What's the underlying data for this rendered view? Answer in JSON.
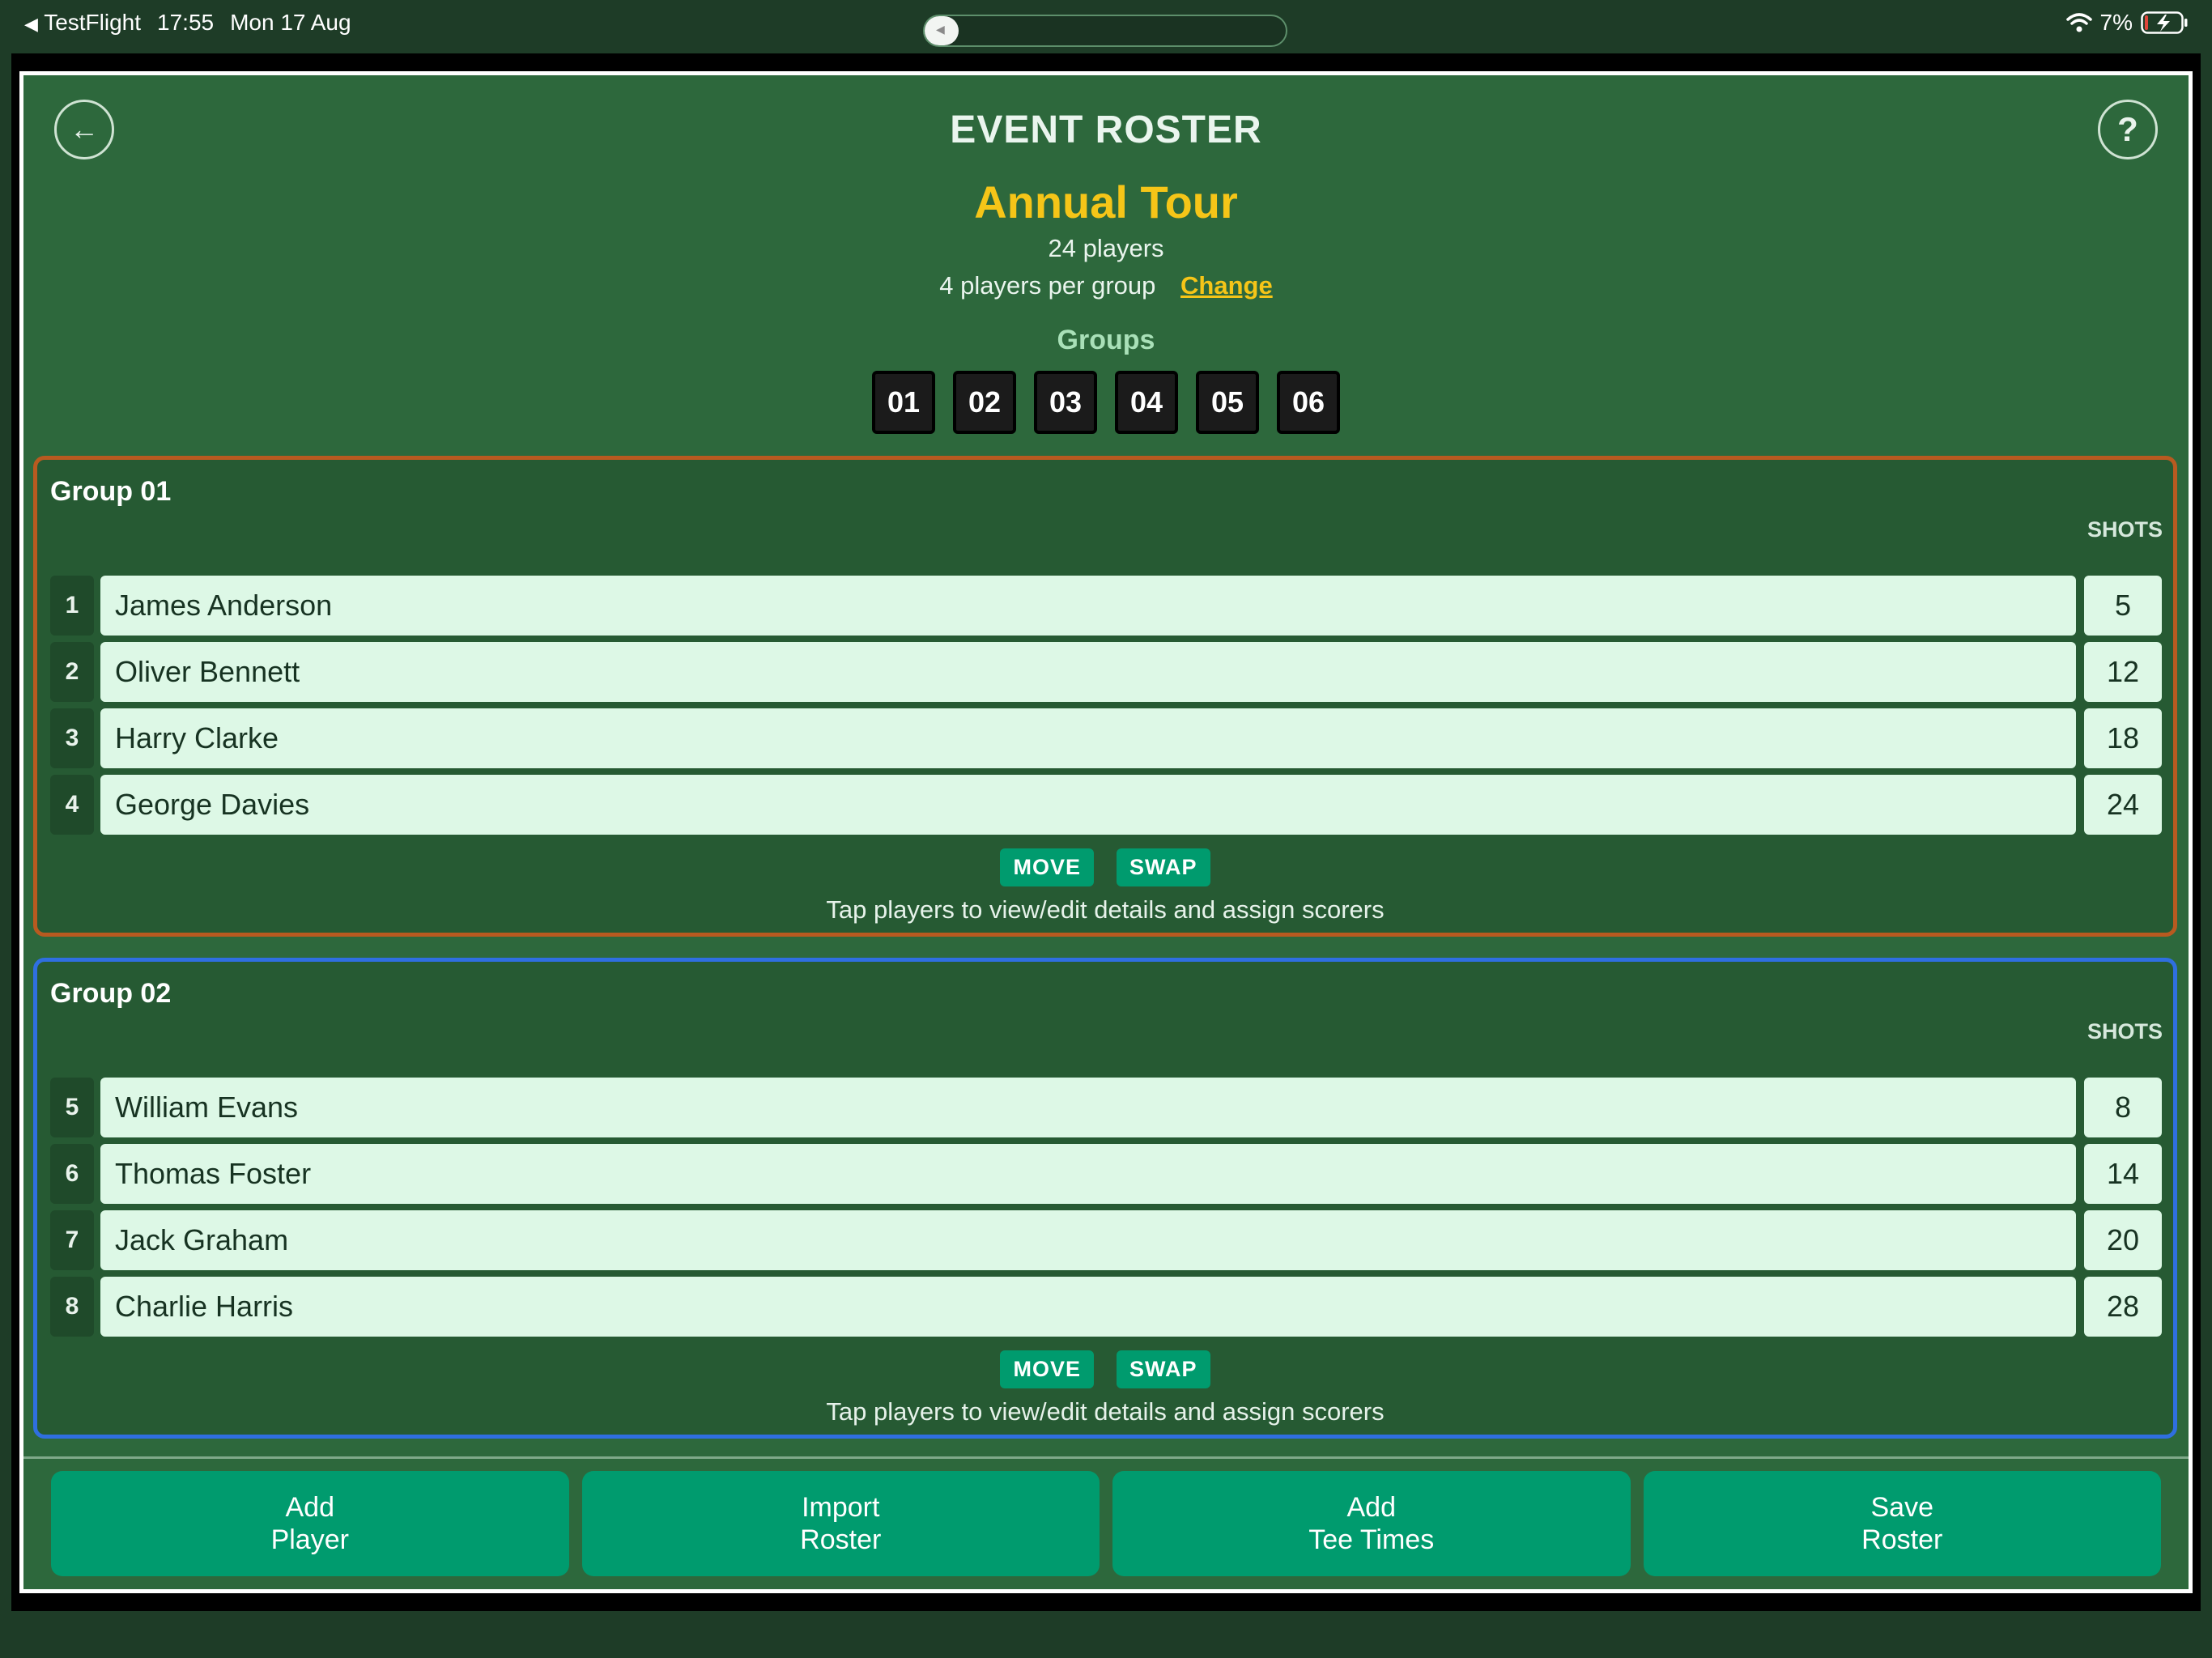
{
  "status_bar": {
    "back_app": "TestFlight",
    "time": "17:55",
    "date": "Mon 17 Aug",
    "battery": "7%"
  },
  "header": {
    "title": "EVENT ROSTER",
    "event_name": "Annual Tour",
    "players_count": "24 players",
    "per_group": "4 players per group",
    "change_label": "Change",
    "help_label": "?",
    "groups_label": "Groups",
    "group_tiles": [
      "01",
      "02",
      "03",
      "04",
      "05",
      "06"
    ]
  },
  "groups": [
    {
      "name": "Group 01",
      "shots_header": "SHOTS",
      "border_color": "#b85a20",
      "players": [
        {
          "num": "1",
          "name": "James Anderson",
          "shots": "5"
        },
        {
          "num": "2",
          "name": "Oliver Bennett",
          "shots": "12"
        },
        {
          "num": "3",
          "name": "Harry Clarke",
          "shots": "18"
        },
        {
          "num": "4",
          "name": "George Davies",
          "shots": "24"
        }
      ],
      "move_label": "MOVE",
      "swap_label": "SWAP",
      "hint": "Tap players to view/edit details and assign scorers"
    },
    {
      "name": "Group 02",
      "shots_header": "SHOTS",
      "border_color": "#2f6fe0",
      "players": [
        {
          "num": "5",
          "name": "William Evans",
          "shots": "8"
        },
        {
          "num": "6",
          "name": "Thomas Foster",
          "shots": "14"
        },
        {
          "num": "7",
          "name": "Jack Graham",
          "shots": "20"
        },
        {
          "num": "8",
          "name": "Charlie Harris",
          "shots": "28"
        }
      ],
      "move_label": "MOVE",
      "swap_label": "SWAP",
      "hint": "Tap players to view/edit details and assign scorers"
    }
  ],
  "bottom_buttons": [
    {
      "line1": "Add",
      "line2": "Player"
    },
    {
      "line1": "Import",
      "line2": "Roster"
    },
    {
      "line1": "Add",
      "line2": "Tee Times"
    },
    {
      "line1": "Save",
      "line2": "Roster"
    }
  ],
  "colors": {
    "background": "#2d683c",
    "accent_yellow": "#f5c518",
    "button_green": "#009b6e",
    "row_fill": "#ddf8e6"
  }
}
